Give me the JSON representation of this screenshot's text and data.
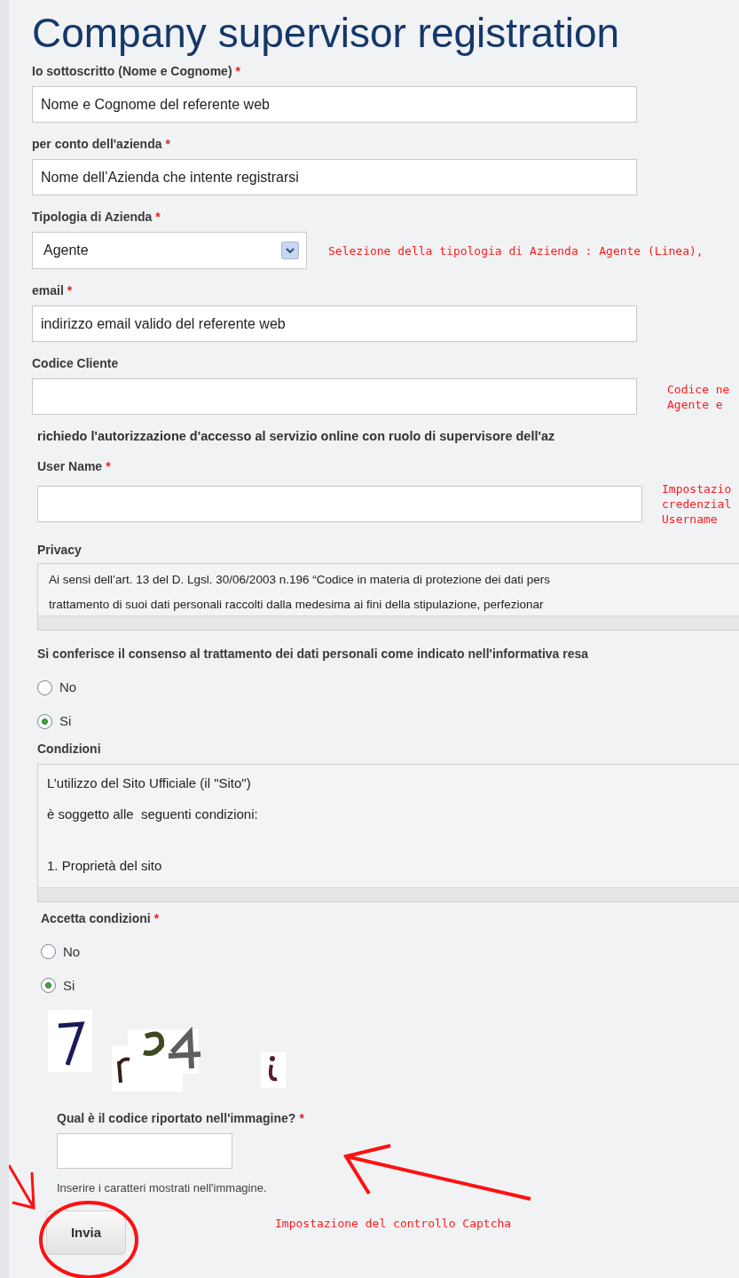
{
  "title": "Company supervisor registration",
  "fields": [
    {
      "kind": "text",
      "label": "Io sottoscritto (Nome e Cognome)",
      "marker": "*",
      "value": "Nome e Cognome del referente web"
    },
    {
      "kind": "text",
      "label": "per conto dell'azienda",
      "marker": "*",
      "value": "Nome dell’Azienda che intente registrarsi"
    },
    {
      "kind": "select",
      "label": "Tipologia di Azienda",
      "marker": "*",
      "value": "Agente",
      "note": [
        "Selezione della tipologia di Azienda : Agente (Linea),"
      ]
    },
    {
      "kind": "text",
      "label": "email",
      "marker": "*",
      "value": "indirizzo email valido del referente web"
    },
    {
      "kind": "text",
      "label": "Codice Cliente",
      "note": [
        "Codice ne",
        "Agente e"
      ]
    }
  ],
  "statement": "richiedo l'autorizzazione d'accesso al servizio online con ruolo di supervisore dell'az",
  "username": {
    "label": "User Name",
    "marker": "*",
    "note": [
      "Impostazio",
      "credenzial",
      "Username"
    ]
  },
  "privacy": {
    "label": "Privacy",
    "lines": [
      "Ai sensi dell’art. 13 del D. Lgsl. 30/06/2003 n.196 “Codice in materia di protezione dei dati pers",
      "trattamento di suoi dati personali raccolti dalla medesima ai fini della stipulazione, perfezionar"
    ]
  },
  "consent": {
    "label": "Si conferisce il consenso al trattamento dei dati personali come indicato nell'informativa resa",
    "options": [
      {
        "label": "No",
        "selected": false
      },
      {
        "label": "Si",
        "selected": true
      }
    ]
  },
  "conditions": {
    "label": "Condizioni",
    "paragraphs": [
      [
        "L’utilizzo del Sito Ufficiale (il \"Sito\")",
        "è soggetto alle  seguenti condizioni:"
      ],
      [
        "1. Proprietà del sito"
      ]
    ]
  },
  "accept": {
    "label": "Accetta condizioni",
    "marker": "*",
    "options": [
      {
        "label": "No",
        "selected": false
      },
      {
        "label": "Si",
        "selected": true
      }
    ]
  },
  "captcha": {
    "label": "Qual è il codice riportato nell'immagine?",
    "marker": "*",
    "help": "Inserire i caratteri mostrati nell'immagine."
  },
  "submit": "Invia",
  "annotation": "Impostazione del controllo Captcha"
}
